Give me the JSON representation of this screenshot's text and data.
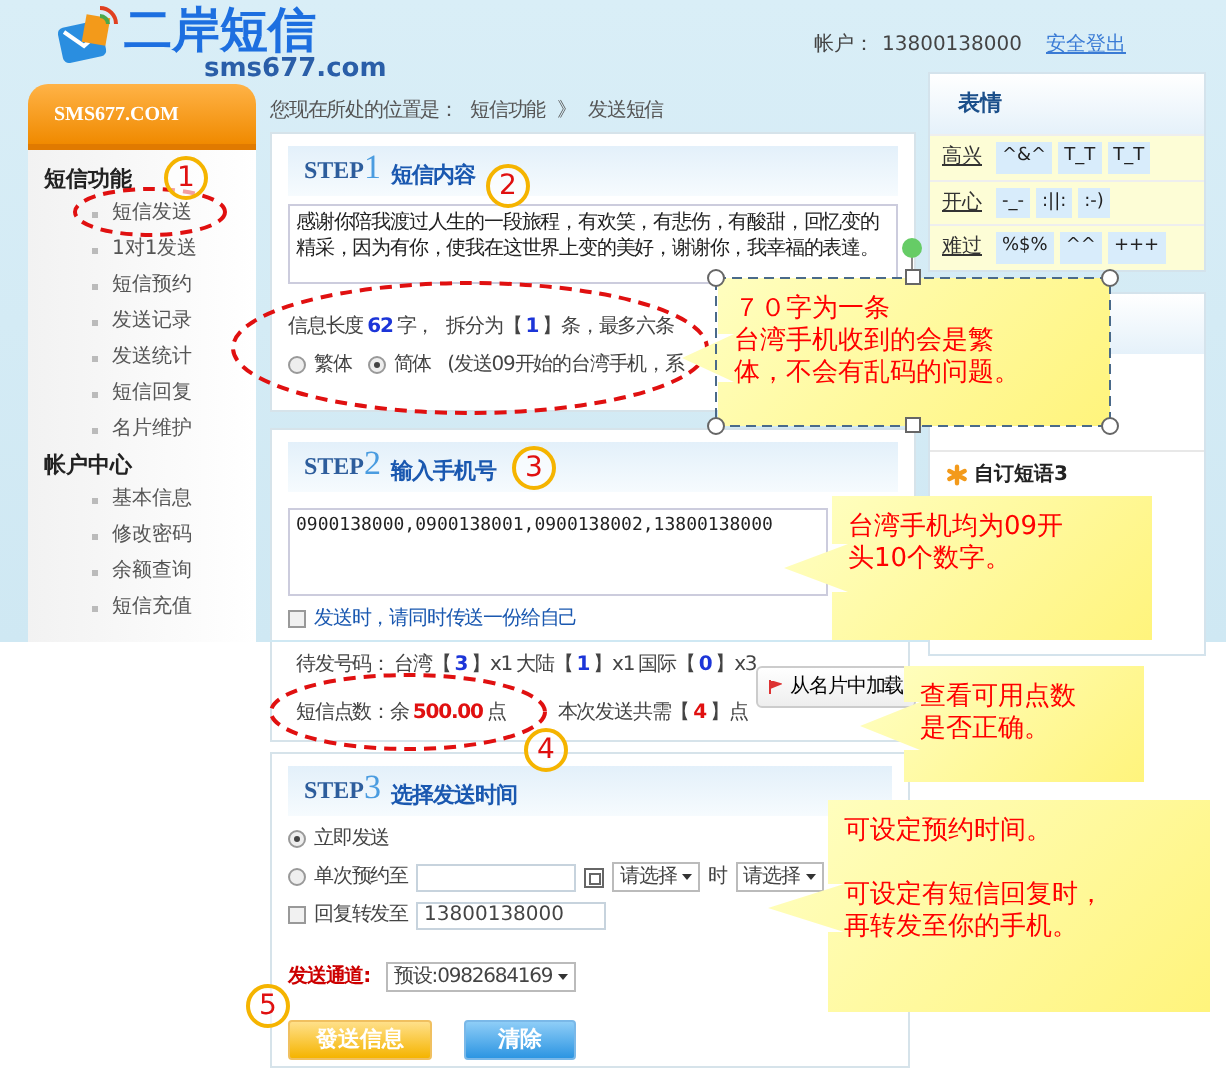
{
  "header": {
    "logo_title": "二岸短信",
    "logo_subtitle": "sms677.com",
    "account_label": "帐户：",
    "account": "13800138000",
    "logout": "安全登出"
  },
  "sidebar": {
    "title": "SMS677.COM",
    "sections": [
      {
        "title": "短信功能",
        "items": [
          "短信发送",
          "1对1发送",
          "短信预约",
          "发送记录",
          "发送统计",
          "短信回复",
          "名片维护"
        ]
      },
      {
        "title": "帐户中心",
        "items": [
          "基本信息",
          "修改密码",
          "余额查询",
          "短信充值"
        ]
      }
    ]
  },
  "breadcrumb": {
    "prefix": "您现在所处的位置是：",
    "path": [
      "短信功能",
      "发送短信"
    ],
    "separator": "》"
  },
  "step1": {
    "step": "STEP",
    "number": "1",
    "title": "短信内容",
    "message": "感谢你陪我渡过人生的一段旅程，有欢笑，有悲伤，有酸甜，回忆变的精采，因为有你，使我在这世界上变的美好，谢谢你，我幸福的表達。",
    "length_label": "信息长度",
    "length": "62",
    "length_unit": "字，",
    "split_prefix": "拆分为【",
    "split_count": "1",
    "split_suffix": "】条，最多六条",
    "encodings": [
      {
        "label": "繁体",
        "selected": false
      },
      {
        "label": "简体",
        "selected": true
      }
    ],
    "encoding_note": "(发送09开始的台湾手机，系"
  },
  "step2": {
    "step": "STEP",
    "number": "2",
    "title": "输入手机号",
    "recipients": "0900138000,0900138001,0900138002,13800138000",
    "copy_self": {
      "label": "发送时，请同时传送一份给自己",
      "checked": false
    }
  },
  "counts": {
    "pending_label": "待发号码：",
    "groups": [
      {
        "name": "台湾【",
        "count": "3",
        "rate": "】x1"
      },
      {
        "name": "大陆【",
        "count": "1",
        "rate": "】x1"
      },
      {
        "name": "国际【",
        "count": "0",
        "rate": "】x3"
      }
    ],
    "balance_label": "短信点数：余",
    "balance": "500.00",
    "balance_unit": "点",
    "cost_prefix": "本次发送共需【",
    "cost": "4",
    "cost_suffix": "】点",
    "load_button": "从名片中加载"
  },
  "step3": {
    "step": "STEP",
    "number": "3",
    "title": "选择发送时间",
    "options": [
      {
        "kind": "now",
        "label": "立即发送",
        "selected": true
      },
      {
        "kind": "schedule",
        "label": "单次预约至",
        "selected": false,
        "hour_select": "请选择",
        "hour_unit": "时",
        "minute_select": "请选择"
      },
      {
        "kind": "forward",
        "label": "回复转发至",
        "checked": false,
        "value": "13800138000"
      }
    ],
    "channel_label": "发送通道:",
    "channel": "预设:0982684169"
  },
  "buttons": [
    {
      "kind": "send",
      "label": "發送信息"
    },
    {
      "kind": "clear",
      "label": "清除"
    }
  ],
  "emoticons": {
    "title": "表情",
    "rows": [
      {
        "label": "高兴",
        "items": [
          "^&^",
          "T_T",
          "T_T"
        ]
      },
      {
        "label": "开心",
        "items": [
          "-_-",
          ":||:",
          ":-)"
        ]
      },
      {
        "label": "难过",
        "items": [
          "%$%",
          "^^",
          "+++"
        ]
      }
    ]
  },
  "phrases": [
    "自订短语3"
  ],
  "markers": [
    "1",
    "2",
    "3",
    "4",
    "5"
  ],
  "callouts": [
    {
      "paragraphs": [
        [
          "７０字为一条",
          "台湾手机收到的会是繁",
          "体，不会有乱码的问题。"
        ]
      ],
      "selected": true
    },
    {
      "paragraphs": [
        [
          "台湾手机均为09开",
          "头10个数字。"
        ]
      ],
      "selected": false
    },
    {
      "paragraphs": [
        [
          "查看可用点数",
          "是否正确。"
        ]
      ],
      "selected": false
    },
    {
      "paragraphs": [
        [
          "可设定预约时间。"
        ],
        [
          "可设定有短信回复时，",
          "再转发至你的手机。"
        ]
      ],
      "selected": false
    }
  ]
}
